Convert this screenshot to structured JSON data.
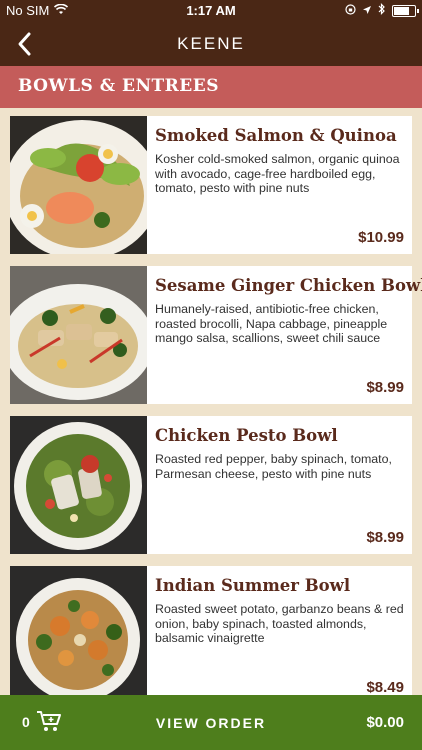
{
  "status": {
    "carrier": "No SIM",
    "time": "1:17 AM"
  },
  "nav": {
    "title": "KEENE"
  },
  "section": {
    "title": "BOWLS & ENTREES"
  },
  "items": [
    {
      "name": "Smoked Salmon & Quinoa",
      "description": "Kosher cold-smoked salmon, organic quinoa with avocado, cage-free hardboiled egg, tomato, pesto with pine nuts",
      "price": "$10.99"
    },
    {
      "name": "Sesame Ginger Chicken Bowl",
      "description": "Humanely-raised, antibiotic-free chicken, roasted brocolli, Napa cabbage, pineapple mango salsa, scallions, sweet chili sauce",
      "price": "$8.99"
    },
    {
      "name": "Chicken Pesto Bowl",
      "description": "Roasted red pepper, baby spinach, tomato, Parmesan cheese,  pesto with pine nuts",
      "price": "$8.99"
    },
    {
      "name": "Indian Summer Bowl",
      "description": "Roasted sweet potato, garbanzo beans & red onion, baby spinach, toasted almonds, balsamic vinaigrette",
      "price": "$8.49"
    }
  ],
  "order": {
    "count": "0",
    "label": "VIEW ORDER",
    "total": "$0.00"
  }
}
